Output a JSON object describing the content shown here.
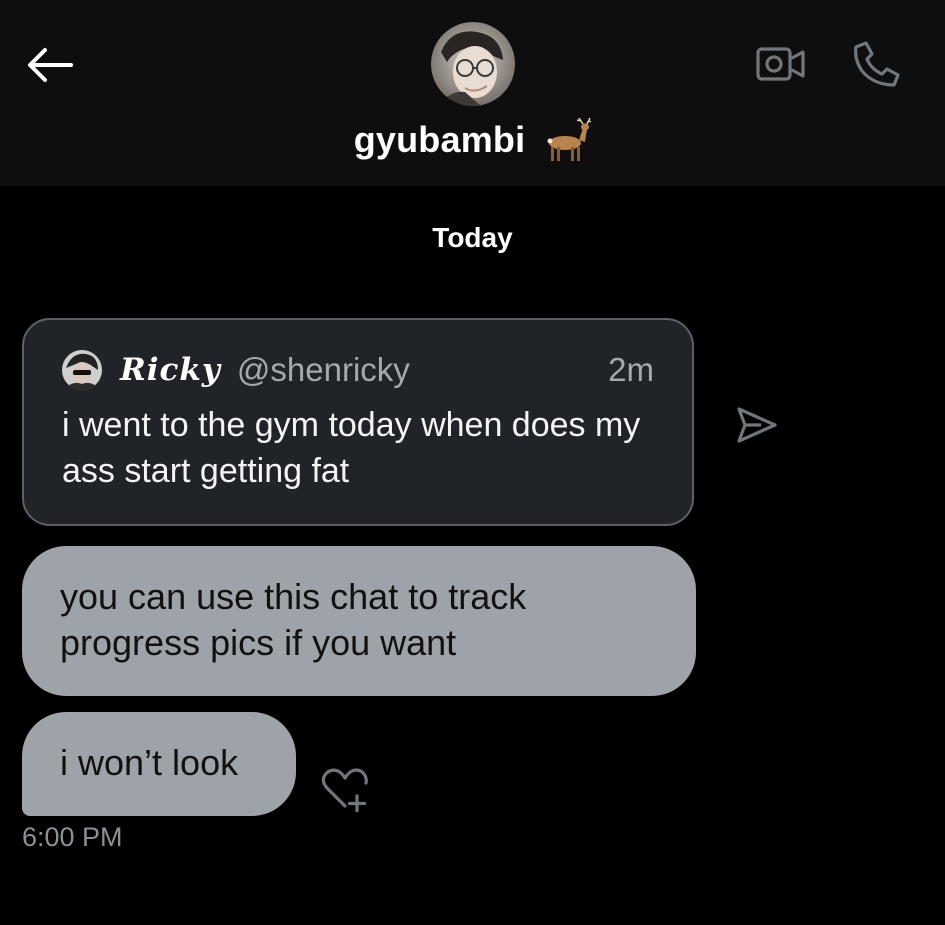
{
  "header": {
    "contact_name": "gyubambi",
    "icons": {
      "back": "arrow-left-icon",
      "video": "video-camera-icon",
      "phone": "phone-icon",
      "name_emoji": "deer-icon"
    }
  },
  "conversation": {
    "date_separator": "Today",
    "shared_post": {
      "author_name": "Ricky",
      "handle": "@shenricky",
      "time": "2m",
      "text": "i went to the gym today when does my ass start getting fat"
    },
    "messages": [
      {
        "text": "you can use this chat to track progress pics if you want"
      },
      {
        "text": "i won’t look"
      }
    ],
    "last_timestamp": "6:00 PM"
  },
  "colors": {
    "background": "#000000",
    "header_background": "#0e0e0e",
    "quote_card_background": "#202327",
    "quote_card_border": "#5b6167",
    "message_bubble": "#9ea3a9",
    "muted_text": "#a3a9ae"
  }
}
